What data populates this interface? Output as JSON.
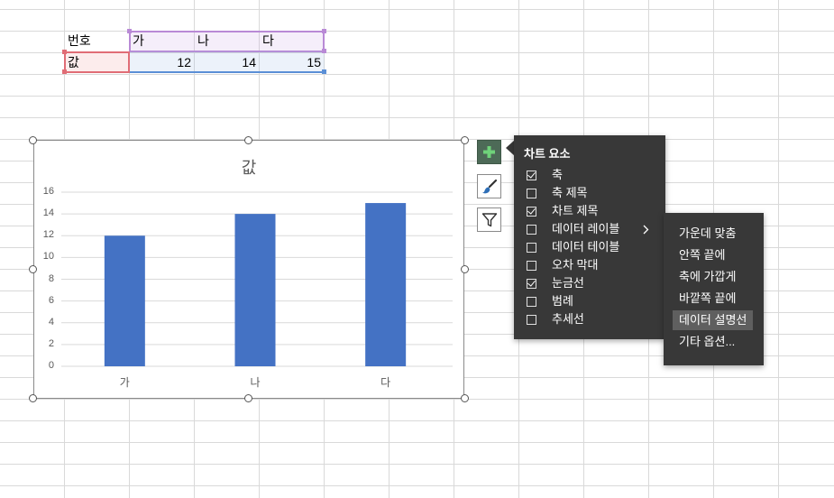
{
  "sheet": {
    "row1": {
      "a": "번호",
      "b": "가",
      "c": "나",
      "d": "다"
    },
    "row2": {
      "a": "값",
      "b": "12",
      "c": "14",
      "d": "15"
    }
  },
  "chart": {
    "title": "값"
  },
  "chart_data": {
    "type": "bar",
    "title": "값",
    "categories": [
      "가",
      "나",
      "다"
    ],
    "series": [
      {
        "name": "값",
        "values": [
          12,
          14,
          15
        ]
      }
    ],
    "ylim": [
      0,
      16
    ],
    "yticks": [
      "0",
      "2",
      "4",
      "6",
      "8",
      "10",
      "12",
      "14",
      "16"
    ],
    "grid": true,
    "bar_color": "#4472c4"
  },
  "side_buttons": [
    "plus-icon",
    "brush-icon",
    "filter-icon"
  ],
  "elements_menu": {
    "title": "차트 요소",
    "items": [
      {
        "label": "축",
        "checked": true
      },
      {
        "label": "축 제목",
        "checked": false
      },
      {
        "label": "차트 제목",
        "checked": true
      },
      {
        "label": "데이터 레이블",
        "checked": false,
        "has_submenu": true
      },
      {
        "label": "데이터 테이블",
        "checked": false
      },
      {
        "label": "오차 막대",
        "checked": false
      },
      {
        "label": "눈금선",
        "checked": true
      },
      {
        "label": "범례",
        "checked": false
      },
      {
        "label": "추세선",
        "checked": false
      }
    ]
  },
  "label_submenu": {
    "items": [
      "가운데 맞춤",
      "안쪽 끝에",
      "축에 가깝게",
      "바깥쪽 끝에",
      "데이터 설명선",
      "기타 옵션..."
    ],
    "highlighted": 4
  },
  "colors": {
    "accent_green": "#4d6a57",
    "bar": "#4472c4",
    "menu_bg": "#383838"
  }
}
